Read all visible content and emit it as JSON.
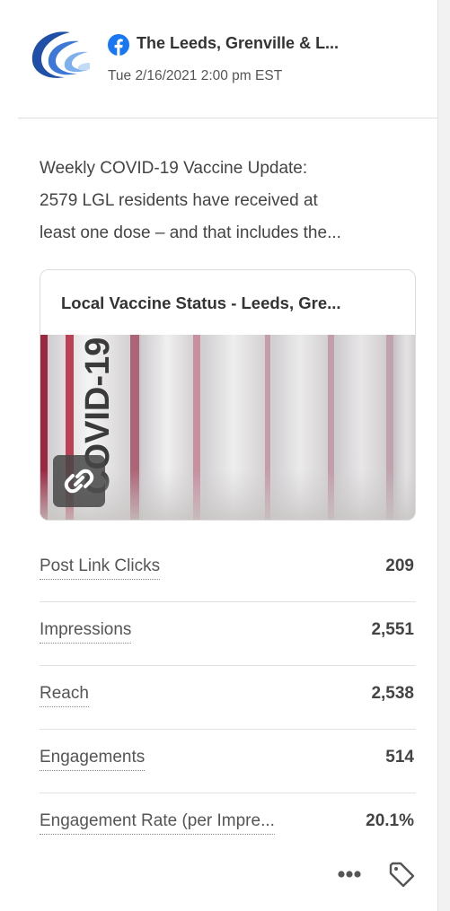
{
  "post": {
    "account_name": "The Leeds, Grenville & L...",
    "timestamp": "Tue 2/16/2021 2:00 pm EST",
    "network_icon": "facebook-icon",
    "text_lines": [
      "Weekly COVID-19 Vaccine Update:",
      "2579 LGL residents have received at",
      "least one dose – and that includes the..."
    ]
  },
  "link_preview": {
    "title": "Local Vaccine Status - Leeds, Gre...",
    "image_caption": "COVID-19",
    "badge_icon": "link-icon"
  },
  "metrics": [
    {
      "label": "Post Link Clicks",
      "value": "209"
    },
    {
      "label": "Impressions",
      "value": "2,551"
    },
    {
      "label": "Reach",
      "value": "2,538"
    },
    {
      "label": "Engagements",
      "value": "514"
    },
    {
      "label": "Engagement Rate (per Impre...",
      "value": "20.1%"
    }
  ],
  "actions": {
    "more_icon": "more-options-icon",
    "tag_icon": "tag-icon"
  },
  "colors": {
    "facebook_blue": "#1877F2",
    "logo_blue": "#1f4fa6",
    "text_dark": "#333333"
  }
}
